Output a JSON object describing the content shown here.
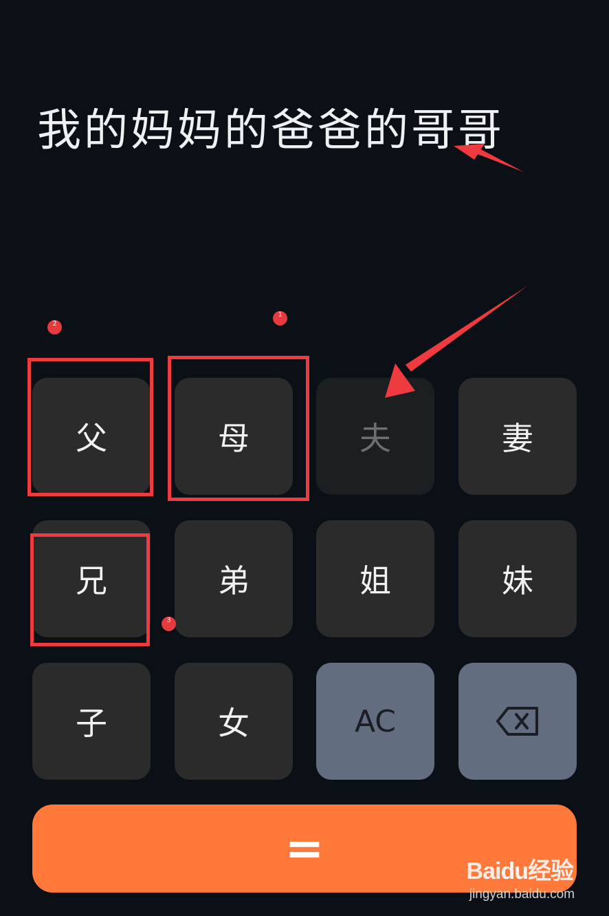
{
  "display": {
    "expression": "我的妈妈的爸爸的哥哥"
  },
  "keypad": {
    "row1": [
      "父",
      "母",
      "夫",
      "妻"
    ],
    "row2": [
      "兄",
      "弟",
      "姐",
      "妹"
    ],
    "row3": [
      "子",
      "女",
      "AC"
    ],
    "equals_label": "="
  },
  "annotations": {
    "dot1": "1",
    "dot2": "2",
    "dot3": "3",
    "color": "#ef3a3f"
  },
  "watermark": {
    "logo_text": "Bai",
    "logo_du": "du",
    "logo_cn": "经验",
    "url": "jingyan.baidu.com"
  },
  "colors": {
    "background": "#0a1016",
    "key": "#2b2b2b",
    "func_key": "#626d80",
    "equals": "#ff7a3a"
  },
  "icons": {
    "backspace": "backspace-icon"
  }
}
